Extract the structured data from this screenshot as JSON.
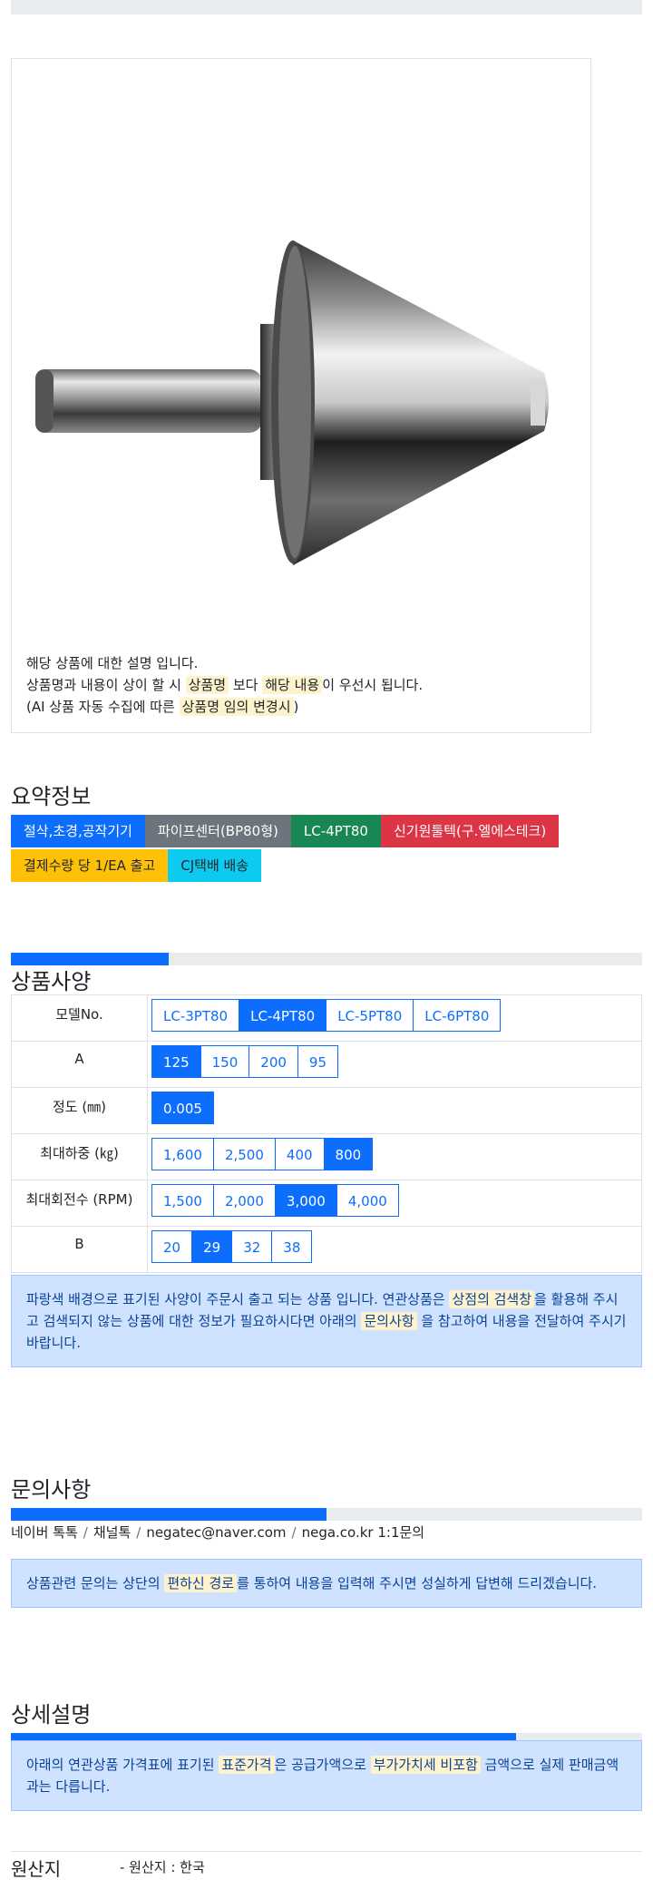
{
  "product": {
    "desc_line1": "해당 상품에 대한 설명 입니다.",
    "desc_line2_a": "상품명과 내용이 상이 할 시",
    "desc_line2_hl1": "상품명",
    "desc_line2_b": "보다",
    "desc_line2_hl2": "해당 내용",
    "desc_line2_c": "이 우선시 됩니다.",
    "desc_line3_a": "(AI 상품 자동 수집에 따른",
    "desc_line3_hl": "상품명 임의 변경시",
    "desc_line3_b": ")"
  },
  "summary": {
    "title": "요약정보",
    "badges": [
      {
        "label": "절삭,초경,공작기기",
        "color": "#0d6efd"
      },
      {
        "label": "파이프센터(BP80형)",
        "color": "#6c757d"
      },
      {
        "label": "LC-4PT80",
        "color": "#198754"
      },
      {
        "label": "신기원툴텍(구.엘에스테크)",
        "color": "#dc3545"
      },
      {
        "label": "결제수량 당 1/EA 출고",
        "color": "#ffc107"
      },
      {
        "label": "CJ택배 배송",
        "color": "#0dcaf0"
      }
    ]
  },
  "progress": {
    "spec_fraction": 0.25,
    "inquiry_fraction": 0.5,
    "detail_fraction": 0.8
  },
  "spec": {
    "title": "상품사양",
    "rows": [
      {
        "label": "모델No.",
        "options": [
          "LC-3PT80",
          "LC-4PT80",
          "LC-5PT80",
          "LC-6PT80"
        ],
        "selected": 1
      },
      {
        "label": "A",
        "options": [
          "125",
          "150",
          "200",
          "95"
        ],
        "selected": 0
      },
      {
        "label": "정도 (㎜)",
        "options": [
          "0.005"
        ],
        "selected": 0
      },
      {
        "label": "최대하중 (㎏)",
        "options": [
          "1,600",
          "2,500",
          "400",
          "800"
        ],
        "selected": 3
      },
      {
        "label": "최대회전수 (RPM)",
        "options": [
          "1,500",
          "2,000",
          "3,000",
          "4,000"
        ],
        "selected": 2
      },
      {
        "label": "B",
        "options": [
          "20",
          "29",
          "32",
          "38"
        ],
        "selected": 1
      }
    ],
    "notice_a": "파랑색 배경으로 표기된 사양이 주문시 출고 되는 상품 입니다. 연관상품은",
    "notice_hl1": "상점의 검색창",
    "notice_b": "을 활용해 주시고 검색되지 않는 상품에 대한 정보가 필요하시다면 아래의",
    "notice_hl2": "문의사항",
    "notice_c": "을 참고하여 내용을 전달하여 주시기 바랍니다."
  },
  "inquiry": {
    "title": "문의사항",
    "contacts": [
      "네이버 톡톡",
      "채널톡",
      "negatec@naver.com",
      "nega.co.kr 1:1문의"
    ],
    "separator": "/",
    "notice_a": "상품관련 문의는 상단의",
    "notice_hl": "편하신 경로",
    "notice_b": "를 통하여 내용을 입력해 주시면 성실하게 답변해 드리겠습니다."
  },
  "detail": {
    "title": "상세설명",
    "notice_a": "아래의 연관상품 가격표에 표기된",
    "notice_hl1": "표준가격",
    "notice_b": "은 공급가액으로",
    "notice_hl2": "부가가치세 비포함",
    "notice_c": "금액으로 실제 판매금액과는 다릅니다."
  },
  "origin": {
    "label": "원산지",
    "value": "- 원산지 : 한국"
  }
}
